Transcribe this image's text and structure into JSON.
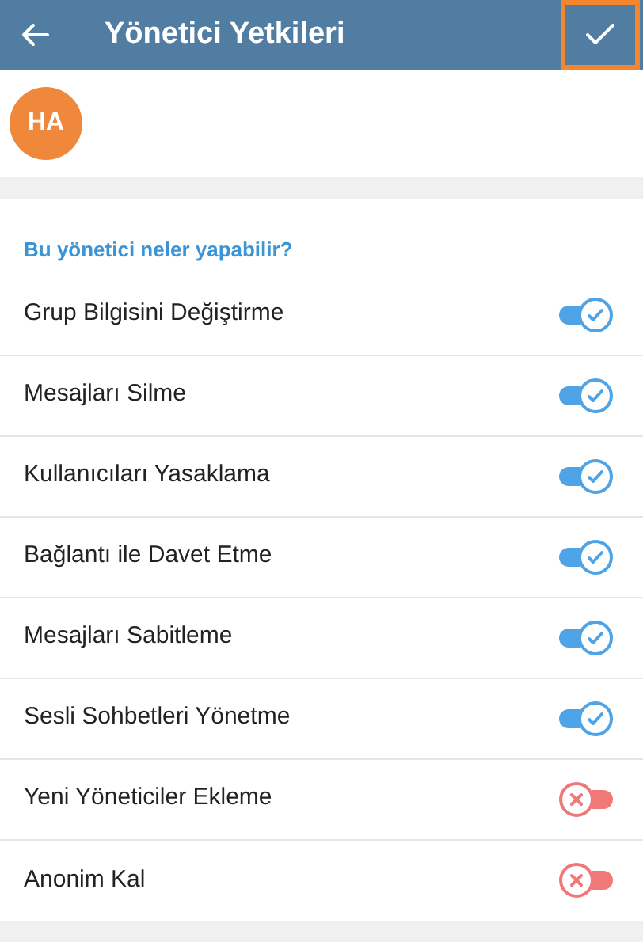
{
  "header": {
    "title": "Yönetici Yetkileri"
  },
  "admin": {
    "initials": "HA"
  },
  "section": {
    "title": "Bu yönetici neler yapabilir?"
  },
  "permissions": [
    {
      "label": "Grup Bilgisini Değiştirme",
      "on": true
    },
    {
      "label": "Mesajları Silme",
      "on": true
    },
    {
      "label": "Kullanıcıları Yasaklama",
      "on": true
    },
    {
      "label": "Bağlantı ile Davet Etme",
      "on": true
    },
    {
      "label": "Mesajları Sabitleme",
      "on": true
    },
    {
      "label": "Sesli Sohbetleri Yönetme",
      "on": true
    },
    {
      "label": "Yeni Yöneticiler Ekleme",
      "on": false
    },
    {
      "label": "Anonim Kal",
      "on": false
    }
  ]
}
